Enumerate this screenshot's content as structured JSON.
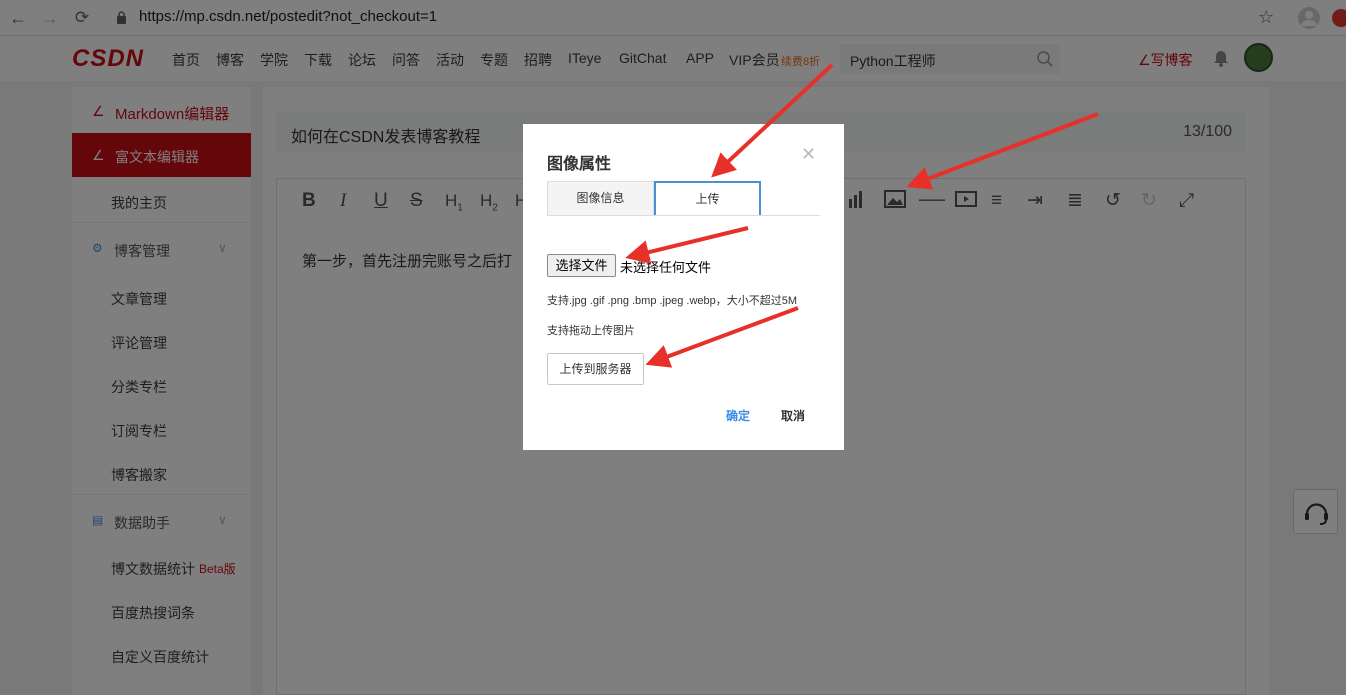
{
  "browser": {
    "url": "https://mp.csdn.net/postedit?not_checkout=1",
    "back_icon": "arrow-left-icon",
    "forward_icon": "arrow-right-icon",
    "reload_icon": "reload-icon",
    "lock_icon": "lock-icon",
    "star_icon": "star-icon",
    "profile_icon": "profile-icon"
  },
  "header": {
    "logo": "CSDN",
    "nav": [
      "首页",
      "博客",
      "学院",
      "下载",
      "论坛",
      "问答",
      "活动",
      "专题",
      "招聘",
      "ITeye",
      "GitChat",
      "APP",
      "VIP会员"
    ],
    "vip_badge": "续费8折",
    "search_value": "Python工程师",
    "write_blog": "写博客",
    "brand_color": "#ca0c16"
  },
  "sidebar": {
    "markdown_editor": "Markdown编辑器",
    "richtext_editor": "富文本编辑器",
    "my_home": "我的主页",
    "blog_manage": "博客管理",
    "items_blog": [
      "文章管理",
      "评论管理",
      "分类专栏",
      "订阅专栏",
      "博客搬家"
    ],
    "data_helper": "数据助手",
    "stats_label": "博文数据统计",
    "stats_badge": "Beta版",
    "items_data": [
      "百度热搜词条",
      "自定义百度统计"
    ]
  },
  "editor": {
    "title": "如何在CSDN发表博客教程",
    "title_count": "13/100",
    "content": "第一步，首先注册完账号之后打"
  },
  "dialog": {
    "title": "图像属性",
    "tabs": [
      "图像信息",
      "上传"
    ],
    "choose_file": "选择文件",
    "no_file": "未选择任何文件",
    "hint_formats": "支持.jpg .gif .png .bmp .jpeg .webp，大小不超过5M",
    "hint_drag": "支持拖动上传图片",
    "upload_server": "上传到服务器",
    "ok": "确定",
    "cancel": "取消",
    "ok_color": "#3a8ee6"
  }
}
